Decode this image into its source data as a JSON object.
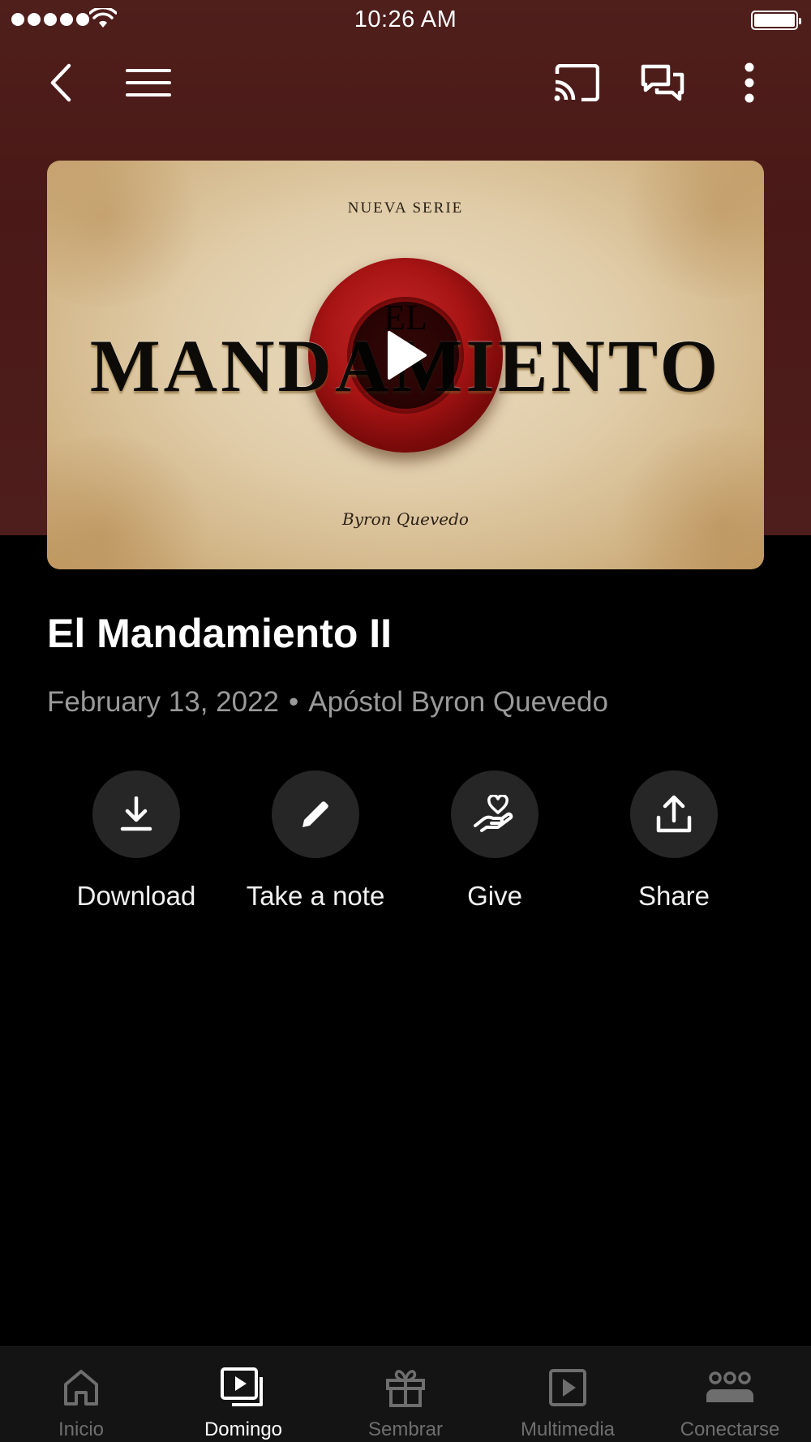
{
  "status_bar": {
    "time": "10:26 AM"
  },
  "top_nav": {
    "back_icon": "chevron-left-icon",
    "menu_icon": "hamburger-icon",
    "cast_icon": "cast-icon",
    "chat_icon": "chat-bubbles-icon",
    "more_icon": "more-vertical-icon"
  },
  "thumbnail": {
    "series_label": "NUEVA SERIE",
    "small_title": "EL",
    "main_title": "MANDAMIENTO",
    "signature": "Byron Quevedo",
    "play_icon": "play-icon"
  },
  "sermon": {
    "title": "El Mandamiento II",
    "date": "February 13, 2022",
    "separator": "•",
    "speaker": "Apóstol Byron Quevedo"
  },
  "actions": [
    {
      "label": "Download",
      "icon": "download-icon"
    },
    {
      "label": "Take a note",
      "icon": "pencil-icon"
    },
    {
      "label": "Give",
      "icon": "heart-hand-icon"
    },
    {
      "label": "Share",
      "icon": "share-upload-icon"
    }
  ],
  "tabs": [
    {
      "label": "Inicio",
      "icon": "home-icon",
      "active": false
    },
    {
      "label": "Domingo",
      "icon": "video-library-icon",
      "active": true
    },
    {
      "label": "Sembrar",
      "icon": "gift-icon",
      "active": false
    },
    {
      "label": "Multimedia",
      "icon": "play-square-icon",
      "active": false
    },
    {
      "label": "Conectarse",
      "icon": "group-icon",
      "active": false
    }
  ],
  "colors": {
    "header_bg": "#4a1917",
    "page_bg": "#000000",
    "action_circle": "#262626",
    "meta_text": "#9a9a9a",
    "tab_inactive": "#6e6e6e",
    "tab_active": "#ffffff"
  }
}
